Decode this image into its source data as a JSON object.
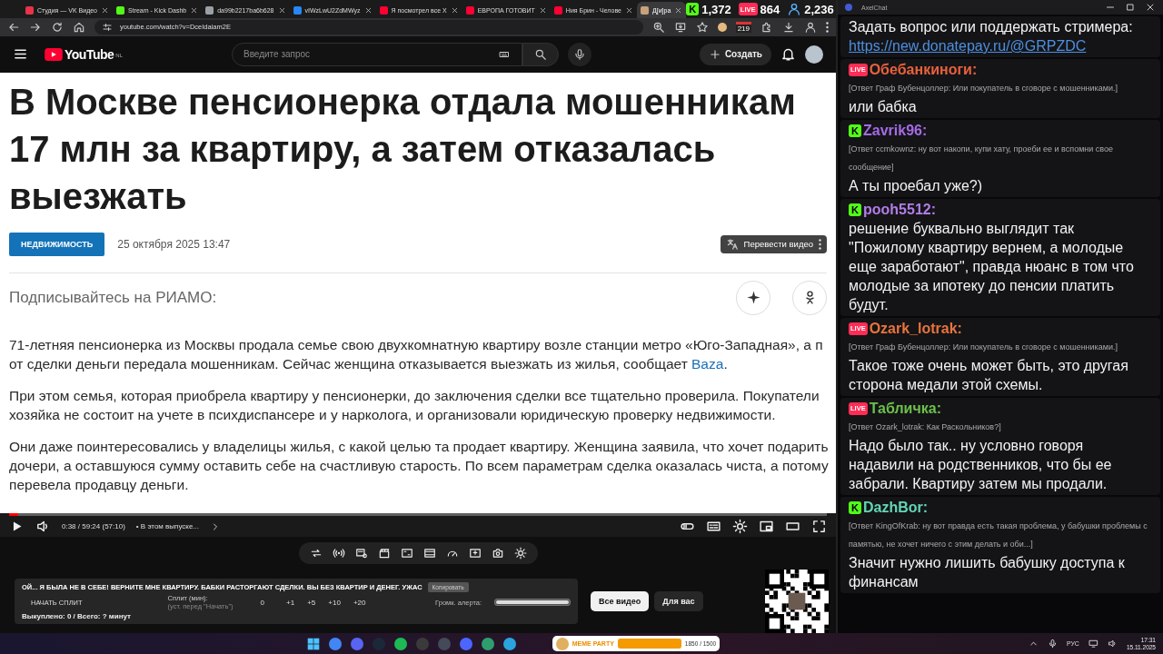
{
  "browser": {
    "tabs": [
      {
        "title": "Студия — VK Видео",
        "color": "#e8334a",
        "selected": false
      },
      {
        "title": "Stream - Kick Dashb",
        "color": "#53fc18",
        "selected": false
      },
      {
        "title": "da99b2217ba6b628",
        "color": "#9aa0a6",
        "selected": false
      },
      {
        "title": "vIWzLwU2ZdMWyz",
        "color": "#2787f5",
        "selected": false
      },
      {
        "title": "Я посмотрел все Х",
        "color": "#ff0033",
        "selected": false
      },
      {
        "title": "ЕВРОПА ГОТОВИТ",
        "color": "#ff0033",
        "selected": false
      },
      {
        "title": "Ния Брин - Челове",
        "color": "#ff0033",
        "selected": false
      },
      {
        "title": "Д[и]ра",
        "color": "#c8a27a",
        "selected": true
      }
    ],
    "address": "youtube.com/watch?v=DceIdaiam2E",
    "badge": "219"
  },
  "stream_stats": [
    {
      "kind": "kick",
      "badge": "K",
      "value": "1,372"
    },
    {
      "kind": "live",
      "badge": "LIVE",
      "value": "864"
    },
    {
      "kind": "viewers",
      "value": "2,236"
    }
  ],
  "youtube": {
    "logo": "YouTube",
    "region": "NL",
    "search_placeholder": "Введите запрос",
    "create": "Создать"
  },
  "video": {
    "translate": "Перевести видео",
    "article": {
      "title": "В Москве пенсионерка отдала мошенникам 17 млн за квартиру, а затем отказалась выезжать",
      "category": "НЕДВИЖИМОСТЬ",
      "date": "25 октября 2025 13:47",
      "subscribe": "Подписывайтесь на РИАМО:",
      "paragraphs": [
        {
          "lines": [
            "71-летняя пенсионерка из Москвы продала семье свою двухкомнатную квартиру возле станции метро «Юго-Западная», а п",
            "от сделки деньги передала мошенникам. Сейчас женщина отказывается выезжать из жилья, сообщает "
          ],
          "link": "Baza",
          "after": "."
        },
        {
          "lines": [
            "При этом семья, которая приобрела квартиру у пенсионерки, до заключения сделки все тщательно проверила. Покупатели",
            "хозяйка не состоит на учете в психдиспансере и у нарколога, и организовали юридическую проверку недвижимости."
          ]
        },
        {
          "lines": [
            "Они даже поинтересовались у владелицы жилья, с какой целью та продает квартиру. Женщина заявила, что хочет подарить",
            "дочери, а оставшуюся сумму оставить себе на счастливую старость. По всем параметрам сделка оказалась чиста, а потому",
            "перевела продавцу деньги."
          ]
        }
      ]
    },
    "progress": {
      "level": 0.011
    },
    "time": "0:38 / 59:24 (57:10)",
    "chapter": "• В этом выпуске..."
  },
  "tools": {
    "alert_text": "ОЙ... Я БЫЛА НЕ В СЕБЕ! ВЕРНИТЕ МНЕ КВАРТИРУ. БАБКИ РАСТОРГАЮТ СДЕЛКИ. ВЫ БЕЗ КВАРТИР И ДЕНЕГ. УЖАС",
    "copy": "Копировать",
    "start_split": "НАЧАТЬ СПЛИТ",
    "split_label": "Сплит (мин):",
    "split_hint": "(уст. перед \"Начать\")",
    "split_value": "0",
    "increments": [
      "+1",
      "+5",
      "+10",
      "+20"
    ],
    "volume_label": "Громк. алерта:",
    "volume": {
      "level": 1
    },
    "summary": "Выкуплено: 0 / Всего: ? минут"
  },
  "chips": [
    {
      "label": "Все видео",
      "selected": true
    },
    {
      "label": "Для вас",
      "selected": false
    }
  ],
  "chat": {
    "title": "AxelChat",
    "intro": "Задать вопрос или поддержать стримера:",
    "intro_link": "https://new.donatepay.ru/@GRPZDC",
    "messages": [
      {
        "kind": "live",
        "badge": "LIVE",
        "name": "Обебанкиноги:",
        "color": "#e8613c",
        "reply": "[Ответ Граф Бубенцоллер: Или покупатель в сговоре с мошенниками.]",
        "text": "или бабка"
      },
      {
        "kind": "kick",
        "badge": "K",
        "name": "Zavrik96:",
        "color": "#a56be6",
        "reply": "[Ответ ccmkownz: ну вот накопи, купи хату, проеби ее и вспомни свое сообщение]",
        "text": "А ты проебал уже?)"
      },
      {
        "kind": "kick",
        "badge": "K",
        "name": "pooh5512:",
        "color": "#b27de8",
        "text": "решение буквально выглядит так \"Пожилому квартиру вернем, а молодые еще заработают\", правда нюанс в том что молодые за ипотеку до пенсии платить будут."
      },
      {
        "kind": "live",
        "badge": "LIVE",
        "name": "Ozark_lotrak:",
        "color": "#e8743c",
        "reply": "[Ответ Граф Бубенцоллер: Или покупатель в сговоре с мошенниками.]",
        "text": "Такое тоже очень может быть, это другая сторона медали этой схемы."
      },
      {
        "kind": "live",
        "badge": "LIVE",
        "name": "Табличка:",
        "color": "#6cc04a",
        "reply": "[Ответ Ozark_lotrak: Как Раскольников?]",
        "text": "Надо было так.. ну условно говоря надавили на родственников, что бы ее забрали. Квартиру затем мы продали."
      },
      {
        "kind": "kick",
        "badge": "K",
        "name": "DazhBor:",
        "color": "#62d6b4",
        "reply": "[Ответ KingOfKrab: ну вот правда есть такая проблема, у бабушки проблемы с памятью, не хочет ничего с этим делать и оби...]",
        "text": "Значит нужно лишить бабушку доступа к финансам"
      }
    ]
  },
  "taskbar": {
    "widget": {
      "title": "MEME PARTY",
      "count": "1850 / 1500",
      "level": 1
    },
    "language": "РУС",
    "time": "17:31",
    "date": "15.11.2025"
  }
}
